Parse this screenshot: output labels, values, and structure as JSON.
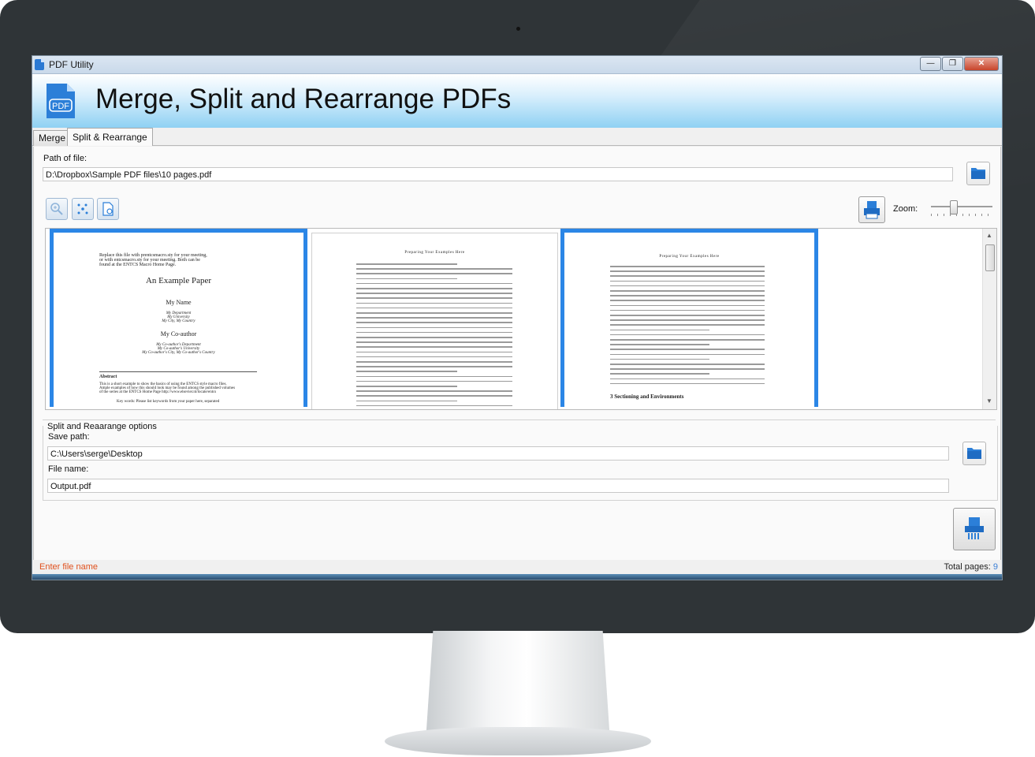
{
  "window": {
    "title": "PDF Utility"
  },
  "banner": {
    "title": "Merge, Split and Rearrange PDFs",
    "icon_text": "PDF"
  },
  "tabs": [
    {
      "label": "Merge",
      "active": false
    },
    {
      "label": "Split & Rearrange",
      "active": true
    }
  ],
  "source": {
    "path_label": "Path of file:",
    "path_value": "D:\\Dropbox\\Sample PDF files\\10 pages.pdf"
  },
  "toolbar": {
    "zoom_label": "Zoom:",
    "zoom_level": 0.35
  },
  "pages": [
    {
      "selected": true,
      "lines": [
        "Replace this file with prentcsmacro.sty for your meeting,",
        "or with entcsmacro.sty for your meeting. Both can be",
        "found at the ENTCS Macro Home Page."
      ],
      "title": "An Example Paper",
      "author1": "My Name",
      "aff1": [
        "My Department",
        "My University",
        "My City, My Country"
      ],
      "author2": "My Co-author",
      "aff2": [
        "My Co-author's Department",
        "My Co-author's University",
        "My Co-author's City, My Co-author's Country"
      ],
      "abstract_head": "Abstract",
      "abstract": [
        "This is a short example to show the basics of using the ENTCS style macro files.",
        "Ample examples of how this should look may be found among the published volumes",
        "of the series at the ENTCS Home Page http://www.elsevier.nl/locate/entcs"
      ],
      "keywords": "Key words: Please list keywords from your paper here, separated"
    },
    {
      "selected": false,
      "running_head": "Preparing Your Examples Here"
    },
    {
      "selected": true,
      "running_head": "Preparing Your Examples Here",
      "section": "3   Sectioning and Environments"
    }
  ],
  "options": {
    "group_title": "Split and Reaarange options",
    "save_label": "Save path:",
    "save_value": "C:\\Users\\serge\\Desktop",
    "name_label": "File name:",
    "name_value": "Output.pdf"
  },
  "status": {
    "message": "Enter file name",
    "total_label": "Total pages:",
    "total_value": "9"
  },
  "colors": {
    "accent": "#2b86e6",
    "status_warning": "#e0501c",
    "banner_bottom": "#8fd1f3"
  }
}
